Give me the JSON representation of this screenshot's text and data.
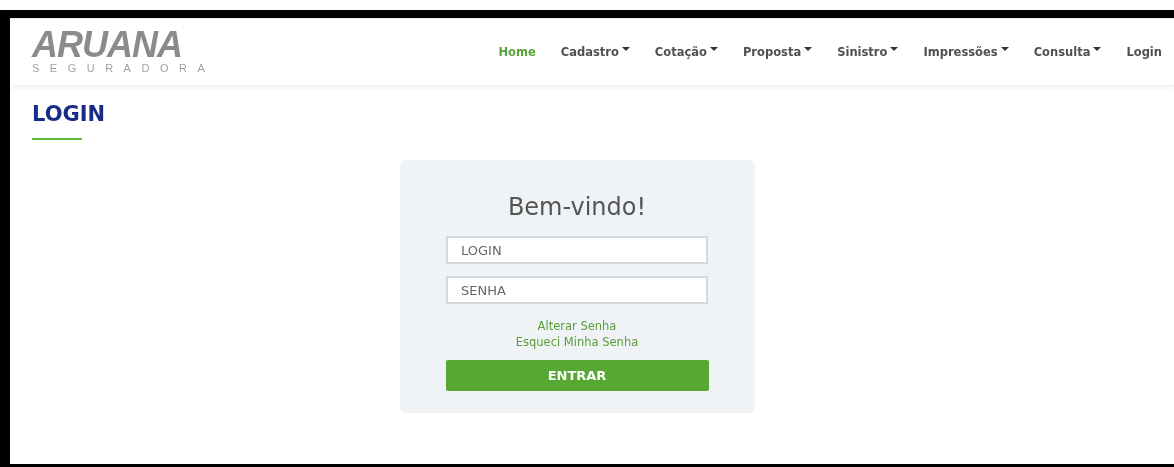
{
  "logo": {
    "name": "ARUANA",
    "tagline": "SEGURADORA"
  },
  "nav": [
    {
      "label": "Home",
      "selected": true,
      "has_menu": false
    },
    {
      "label": "Cadastro",
      "selected": false,
      "has_menu": true
    },
    {
      "label": "Cotação",
      "selected": false,
      "has_menu": true
    },
    {
      "label": "Proposta",
      "selected": false,
      "has_menu": true
    },
    {
      "label": "Sinistro",
      "selected": false,
      "has_menu": true
    },
    {
      "label": "Impressões",
      "selected": false,
      "has_menu": true
    },
    {
      "label": "Consulta",
      "selected": false,
      "has_menu": true
    },
    {
      "label": "Login",
      "selected": false,
      "has_menu": false
    }
  ],
  "page_title": "LOGIN",
  "login_card": {
    "title": "Bem-vindo!",
    "fields": [
      {
        "placeholder": "LOGIN"
      },
      {
        "placeholder": "SENHA"
      }
    ],
    "links": [
      "Alterar Senha",
      "Esqueci Minha Senha"
    ],
    "submit": "ENTRAR"
  }
}
